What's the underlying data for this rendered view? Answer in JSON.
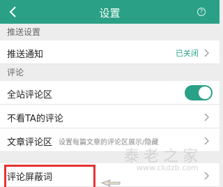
{
  "header": {
    "title": "设置",
    "help_glyph": "?",
    "back_icon": "chevron-left-icon"
  },
  "sections": {
    "push": "推送设置",
    "comment": "评论"
  },
  "rows": {
    "push_notify": {
      "label": "推送通知",
      "value": "已关闭"
    },
    "site_comment": {
      "label": "全站评论区",
      "toggle_on": true
    },
    "block_ta": {
      "label": "不看TA的评论"
    },
    "article_comment": {
      "label": "文章评论区",
      "desc": "设置每篇文章的评论区展示/隐藏"
    },
    "blocked_words": {
      "label": "评论屏蔽词"
    }
  },
  "colors": {
    "accent": "#2aa186",
    "highlight": "#e53333"
  },
  "watermark": {
    "text": "泰老之家",
    "url": "www.ckdzb.com"
  }
}
